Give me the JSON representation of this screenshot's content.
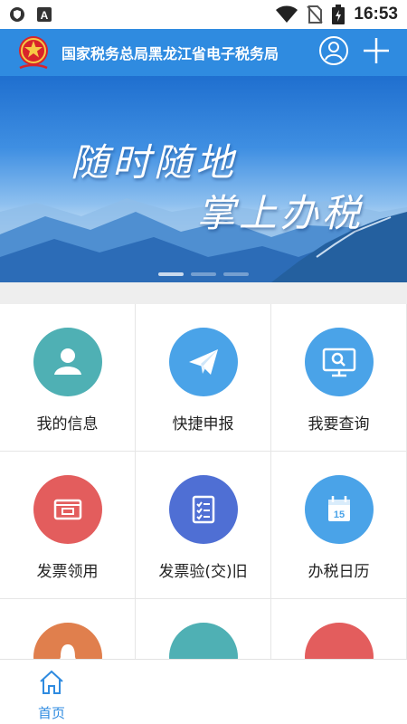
{
  "status_bar": {
    "time": "16:53",
    "icons": [
      "shield-icon",
      "a-icon",
      "wifi-icon",
      "no-sim-icon",
      "battery-icon"
    ]
  },
  "header": {
    "title": "国家税务总局黑龙江省电子税务局",
    "emblem": "tax-emblem-icon",
    "actions": [
      "user-icon",
      "plus-icon"
    ],
    "accent": "#2f8be0"
  },
  "banner": {
    "slogan_line1": "随时随地",
    "slogan_line2": "掌上办税",
    "slides": 3,
    "active_slide": 1
  },
  "grid": {
    "items": [
      {
        "label": "我的信息",
        "icon": "person-icon",
        "color": "#4fb0b4"
      },
      {
        "label": "快捷申报",
        "icon": "paper-plane-icon",
        "color": "#4aa3e8"
      },
      {
        "label": "我要查询",
        "icon": "monitor-search-icon",
        "color": "#4aa3e8"
      },
      {
        "label": "发票领用",
        "icon": "invoice-icon",
        "color": "#e35d5d"
      },
      {
        "label": "发票验(交)旧",
        "icon": "checklist-icon",
        "color": "#4f6fd4"
      },
      {
        "label": "办税日历",
        "icon": "calendar-icon",
        "color": "#4aa3e8",
        "calendar_day": "15"
      },
      {
        "label": "",
        "icon": "bell-icon",
        "color": "#e07f4d"
      },
      {
        "label": "",
        "icon": "partial-icon",
        "color": "#4fb0b4"
      },
      {
        "label": "",
        "icon": "partial-icon",
        "color": "#e35d5d"
      }
    ]
  },
  "bottom_nav": {
    "items": [
      {
        "label": "首页",
        "icon": "home-icon",
        "active": true
      }
    ]
  }
}
